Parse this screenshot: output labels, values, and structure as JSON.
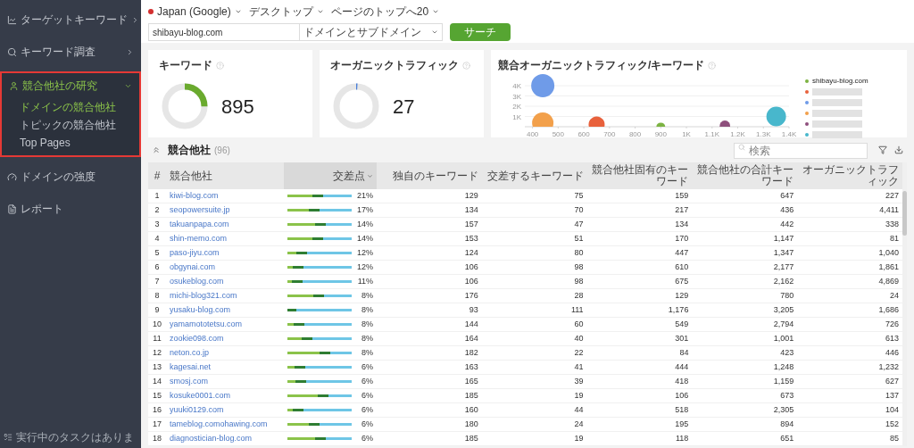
{
  "sidebar": {
    "items": [
      {
        "label": "ターゲットキーワード",
        "kind": "menu",
        "expanded": false,
        "highlighted": false
      },
      {
        "label": "キーワード調査",
        "kind": "menu",
        "expanded": false,
        "highlighted": false
      },
      {
        "label": "競合他社の研究",
        "kind": "menu",
        "expanded": true,
        "highlighted": true,
        "children": [
          {
            "label": "ドメインの競合他社",
            "selected": true
          },
          {
            "label": "トピックの競合他社",
            "selected": false
          },
          {
            "label": "Top Pages",
            "selected": false
          }
        ]
      },
      {
        "label": "ドメインの強度",
        "kind": "link",
        "expanded": false,
        "highlighted": false
      },
      {
        "label": "レポート",
        "kind": "link",
        "expanded": false,
        "highlighted": false
      }
    ],
    "task_status": "実行中のタスクはありま"
  },
  "toolbar": {
    "dropdowns": [
      "Japan (Google)",
      "デスクトップ",
      "ページのトップへ20"
    ],
    "domain": "shibayu-blog.com",
    "scope": "ドメインとサブドメイン",
    "search_button": "サーチ"
  },
  "cards": [
    {
      "title": "キーワード",
      "value": "895",
      "level": 0.25,
      "color": "#6aaa2e"
    },
    {
      "title": "オーガニックトラフィック",
      "value": "27",
      "level": 0.01,
      "color": "#4a7fd8"
    }
  ],
  "bubble_card": {
    "title": "競合オーガニックトラフィック/キーワード",
    "chart_data": {
      "type": "scatter",
      "grid": true,
      "x": [
        900,
        650,
        440,
        440,
        1150,
        1350
      ],
      "series": [
        {
          "name": "shibayu-blog.com",
          "color": "#7cb342",
          "values": [
            200,
            null,
            null,
            null,
            null,
            null
          ]
        },
        {
          "color": "#e8613c",
          "values": [
            null,
            500,
            null,
            null,
            null,
            null
          ]
        },
        {
          "color": "#6f9be8",
          "values": [
            null,
            null,
            4000,
            null,
            null,
            null
          ]
        },
        {
          "color": "#f2a04b",
          "values": [
            null,
            null,
            null,
            700,
            null,
            null
          ]
        },
        {
          "color": "#8e4f7c",
          "values": [
            null,
            null,
            null,
            null,
            300,
            null
          ]
        },
        {
          "color": "#48b7cc",
          "values": [
            null,
            null,
            null,
            null,
            null,
            1000
          ]
        }
      ],
      "xlim": [
        370,
        1400
      ],
      "ylim": [
        0,
        4000
      ],
      "xticks": [
        {
          "value": 400,
          "label": "400"
        },
        {
          "value": 500,
          "label": "500"
        },
        {
          "value": 600,
          "label": "600"
        },
        {
          "value": 700,
          "label": "700"
        },
        {
          "value": 800,
          "label": "800"
        },
        {
          "value": 900,
          "label": "900"
        },
        {
          "value": 1000,
          "label": "1K"
        },
        {
          "value": 1100,
          "label": "1.1K"
        },
        {
          "value": 1200,
          "label": "1.2K"
        },
        {
          "value": 1300,
          "label": "1.3K"
        },
        {
          "value": 1400,
          "label": "1.4K"
        }
      ],
      "yticks": [
        {
          "value": 1000,
          "label": "1K"
        },
        {
          "value": 2000,
          "label": "2K"
        },
        {
          "value": 3000,
          "label": "3K"
        },
        {
          "value": 4000,
          "label": "4K"
        }
      ]
    }
  },
  "competitors": {
    "title": "競合他社",
    "count": "(96)",
    "search_placeholder": "検索",
    "columns": [
      {
        "label": "#",
        "sorted": false
      },
      {
        "label": "競合他社",
        "sorted": false
      },
      {
        "label": "交差点",
        "sorted": true
      },
      {
        "label": "独自のキーワード",
        "sorted": false
      },
      {
        "label": "交差するキーワード",
        "sorted": false
      },
      {
        "label": "競合他社固有のキーワード",
        "sorted": false
      },
      {
        "label": "競合他社の合計キーワード",
        "sorted": false
      },
      {
        "label": "オーガニックトラフィック",
        "sorted": false
      }
    ],
    "rows": [
      {
        "level": 0.55,
        "cells": [
          "1",
          "kiwi-blog.com",
          "21%",
          "129",
          "75",
          "159",
          "647",
          "227"
        ]
      },
      {
        "level": 0.5,
        "cells": [
          "2",
          "seopowersuite.jp",
          "17%",
          "134",
          "70",
          "217",
          "436",
          "4,411"
        ]
      },
      {
        "level": 0.6,
        "cells": [
          "3",
          "takuanpapa.com",
          "14%",
          "157",
          "47",
          "134",
          "442",
          "338"
        ]
      },
      {
        "level": 0.55,
        "cells": [
          "4",
          "shin-memo.com",
          "14%",
          "153",
          "51",
          "170",
          "1,147",
          "81"
        ]
      },
      {
        "level": 0.31,
        "cells": [
          "5",
          "paso-jiyu.com",
          "12%",
          "124",
          "80",
          "447",
          "1,347",
          "1,040"
        ]
      },
      {
        "level": 0.25,
        "cells": [
          "6",
          "obgynai.com",
          "12%",
          "106",
          "98",
          "610",
          "2,177",
          "1,861"
        ]
      },
      {
        "level": 0.23,
        "cells": [
          "7",
          "osukeblog.com",
          "11%",
          "106",
          "98",
          "675",
          "2,162",
          "4,869"
        ]
      },
      {
        "level": 0.57,
        "cells": [
          "8",
          "michi-blog321.com",
          "8%",
          "176",
          "28",
          "129",
          "780",
          "24"
        ]
      },
      {
        "level": 0.14,
        "cells": [
          "9",
          "yusaku-blog.com",
          "8%",
          "93",
          "111",
          "1,176",
          "3,205",
          "1,686"
        ]
      },
      {
        "level": 0.26,
        "cells": [
          "10",
          "yamamototetsu.com",
          "8%",
          "144",
          "60",
          "549",
          "2,794",
          "726"
        ]
      },
      {
        "level": 0.39,
        "cells": [
          "11",
          "zookie098.com",
          "8%",
          "164",
          "40",
          "301",
          "1,001",
          "613"
        ]
      },
      {
        "level": 0.67,
        "cells": [
          "12",
          "neton.co.jp",
          "8%",
          "182",
          "22",
          "84",
          "423",
          "446"
        ]
      },
      {
        "level": 0.28,
        "cells": [
          "13",
          "kagesai.net",
          "6%",
          "163",
          "41",
          "444",
          "1,248",
          "1,232"
        ]
      },
      {
        "level": 0.29,
        "cells": [
          "14",
          "smosj.com",
          "6%",
          "165",
          "39",
          "418",
          "1,159",
          "627"
        ]
      },
      {
        "level": 0.64,
        "cells": [
          "15",
          "kosuke0001.com",
          "6%",
          "185",
          "19",
          "106",
          "673",
          "137"
        ]
      },
      {
        "level": 0.25,
        "cells": [
          "16",
          "yuuki0129.com",
          "6%",
          "160",
          "44",
          "518",
          "2,305",
          "104"
        ]
      },
      {
        "level": 0.5,
        "cells": [
          "17",
          "tameblog.comohawing.com",
          "6%",
          "180",
          "24",
          "195",
          "894",
          "152"
        ]
      },
      {
        "level": 0.6,
        "cells": [
          "18",
          "diagnostician-blog.com",
          "6%",
          "185",
          "19",
          "118",
          "651",
          "85"
        ]
      }
    ]
  }
}
